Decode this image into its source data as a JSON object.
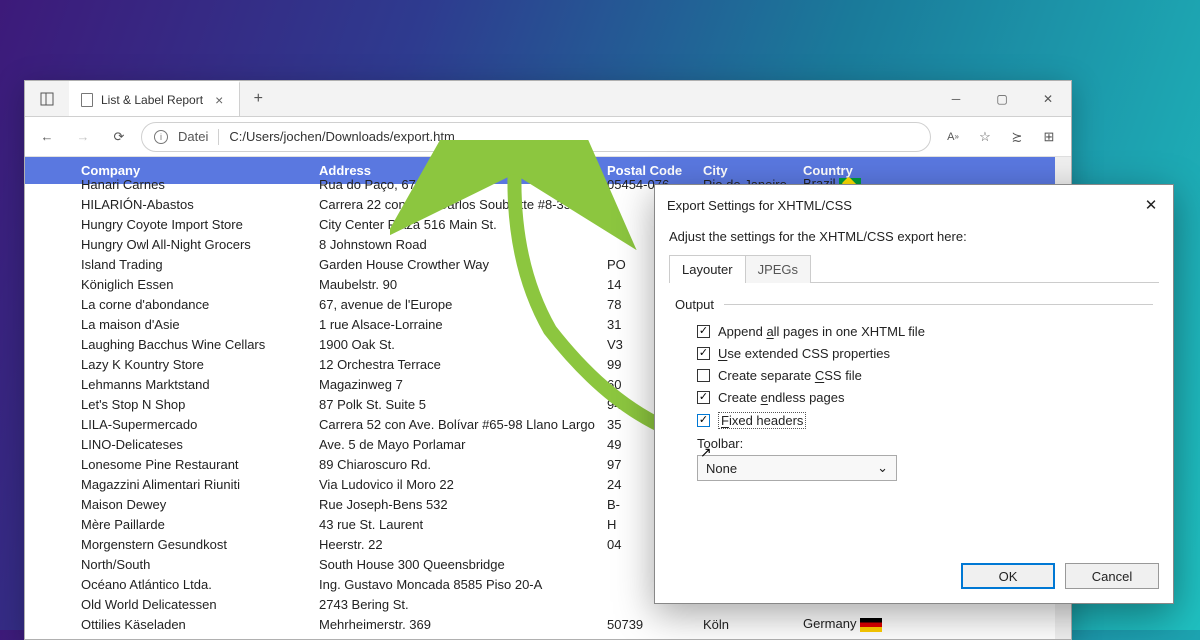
{
  "browser": {
    "tab_title": "List & Label Report",
    "addr_prefix": "Datei",
    "addr_path": "C:/Users/jochen/Downloads/export.htm"
  },
  "table": {
    "headers": {
      "company": "Company",
      "address": "Address",
      "postal": "Postal Code",
      "city": "City",
      "country": "Country"
    },
    "rows": [
      {
        "company": "Hanari Carnes",
        "address": "Rua do Paço, 67",
        "postal": "05454-076",
        "city": "Rio de Janeiro",
        "country": "Brazil",
        "flag": "br"
      },
      {
        "company": "HILARIÓN-Abastos",
        "address": "Carrera 22 con Ave. Carlos Soublette #8-35",
        "postal": ""
      },
      {
        "company": "Hungry Coyote Import Store",
        "address": "City Center Plaza 516 Main St.",
        "postal": "97"
      },
      {
        "company": "Hungry Owl All-Night Grocers",
        "address": "8 Johnstown Road",
        "postal": ""
      },
      {
        "company": "Island Trading",
        "address": "Garden House Crowther Way",
        "postal": "PO"
      },
      {
        "company": "Königlich Essen",
        "address": "Maubelstr. 90",
        "postal": "14"
      },
      {
        "company": "La corne d'abondance",
        "address": "67, avenue de l'Europe",
        "postal": "78"
      },
      {
        "company": "La maison d'Asie",
        "address": "1 rue Alsace-Lorraine",
        "postal": "31"
      },
      {
        "company": "Laughing Bacchus Wine Cellars",
        "address": "1900 Oak St.",
        "postal": "V3"
      },
      {
        "company": "Lazy K Kountry Store",
        "address": "12 Orchestra Terrace",
        "postal": "99"
      },
      {
        "company": "Lehmanns Marktstand",
        "address": "Magazinweg 7",
        "postal": "60"
      },
      {
        "company": "Let's Stop N Shop",
        "address": "87 Polk St. Suite 5",
        "postal": "94"
      },
      {
        "company": "LILA-Supermercado",
        "address": "Carrera 52 con Ave. Bolívar #65-98 Llano Largo",
        "postal": "35"
      },
      {
        "company": "LINO-Delicateses",
        "address": "Ave. 5 de Mayo Porlamar",
        "postal": "49"
      },
      {
        "company": "Lonesome Pine Restaurant",
        "address": "89 Chiaroscuro Rd.",
        "postal": "97"
      },
      {
        "company": "Magazzini Alimentari Riuniti",
        "address": "Via Ludovico il Moro 22",
        "postal": "24"
      },
      {
        "company": "Maison Dewey",
        "address": "Rue Joseph-Bens 532",
        "postal": "B-"
      },
      {
        "company": "Mère Paillarde",
        "address": "43 rue St. Laurent",
        "postal": "H"
      },
      {
        "company": "Morgenstern Gesundkost",
        "address": "Heerstr. 22",
        "postal": "04"
      },
      {
        "company": "North/South",
        "address": "South House 300 Queensbridge",
        "postal": ""
      },
      {
        "company": "Océano Atlántico Ltda.",
        "address": "Ing. Gustavo Moncada 8585 Piso 20-A",
        "postal": ""
      },
      {
        "company": "Old World Delicatessen",
        "address": "2743 Bering St.",
        "postal": ""
      },
      {
        "company": "Ottilies Käseladen",
        "address": "Mehrheimerstr. 369",
        "postal": "50739",
        "city": "Köln",
        "country": "Germany",
        "flag": "de"
      }
    ]
  },
  "dialog": {
    "title": "Export Settings for XHTML/CSS",
    "subtitle": "Adjust the settings for the XHTML/CSS export here:",
    "tabs": {
      "layouter": "Layouter",
      "jpegs": "JPEGs"
    },
    "output_label": "Output",
    "checks": {
      "append": {
        "pre": "Append ",
        "u": "a",
        "post": "ll pages in one XHTML file",
        "checked": true
      },
      "extended": {
        "pre": "",
        "u": "U",
        "post": "se extended CSS properties",
        "checked": true
      },
      "separate": {
        "pre": "Create separate ",
        "u": "C",
        "post": "SS file",
        "checked": false
      },
      "endless": {
        "pre": "Create ",
        "u": "e",
        "post": "ndless pages",
        "checked": true
      },
      "fixed": {
        "pre": "",
        "u": "F",
        "post": "ixed headers",
        "checked": true
      }
    },
    "toolbar_label": "Toolbar:",
    "toolbar_value": "None",
    "ok": "OK",
    "cancel": "Cancel"
  }
}
